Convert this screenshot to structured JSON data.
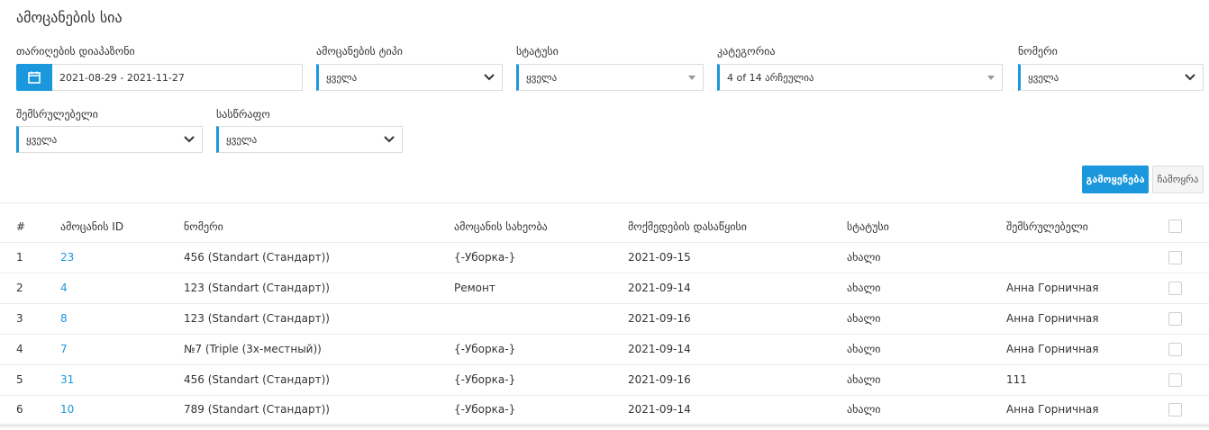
{
  "page": {
    "title": "ამოცანების სია"
  },
  "filters": {
    "date_range": {
      "label": "თარიღების დიაპაზონი",
      "value": "2021-08-29 - 2021-11-27",
      "icon": "calendar-icon"
    },
    "task_type": {
      "label": "ამოცანების ტიპი",
      "value": "ყველა"
    },
    "status": {
      "label": "სტატუსი",
      "value": "ყველა"
    },
    "category": {
      "label": "კატეგორია",
      "value": "4 of 14 არჩეულია"
    },
    "room": {
      "label": "ნომერი",
      "value": "ყველა"
    },
    "assignee": {
      "label": "შემსრულებელი",
      "value": "ყველა"
    },
    "housekeeping": {
      "label": "სასწრაფო",
      "value": "ყველა"
    }
  },
  "actions": {
    "apply_label": "გამოყენება",
    "clear_label": "ჩამოყრა"
  },
  "table": {
    "columns": [
      "#",
      "ამოცანის ID",
      "ნომერი",
      "ამოცანის სახეობა",
      "მოქმედების დასაწყისი",
      "სტატუსი",
      "შემსრულებელი"
    ],
    "rows": [
      {
        "num": "1",
        "id": "23",
        "room": "456 (Standart (Стандарт))",
        "type": "{-Уборка-}",
        "start": "2021-09-15",
        "status": "ახალი",
        "assignee": ""
      },
      {
        "num": "2",
        "id": "4",
        "room": "123 (Standart (Стандарт))",
        "type": "Ремонт",
        "start": "2021-09-14",
        "status": "ახალი",
        "assignee": "Анна Горничная"
      },
      {
        "num": "3",
        "id": "8",
        "room": "123 (Standart (Стандарт))",
        "type": "",
        "start": "2021-09-16",
        "status": "ახალი",
        "assignee": "Анна Горничная"
      },
      {
        "num": "4",
        "id": "7",
        "room": "№7 (Triple (3х-местный))",
        "type": "{-Уборка-}",
        "start": "2021-09-14",
        "status": "ახალი",
        "assignee": "Анна Горничная"
      },
      {
        "num": "5",
        "id": "31",
        "room": "456 (Standart (Стандарт))",
        "type": "{-Уборка-}",
        "start": "2021-09-16",
        "status": "ახალი",
        "assignee": "111"
      },
      {
        "num": "6",
        "id": "10",
        "room": "789 (Standart (Стандарт))",
        "type": "{-Уборка-}",
        "start": "2021-09-14",
        "status": "ახალი",
        "assignee": "Анна Горничная"
      }
    ]
  },
  "colors": {
    "accent": "#1a97dd",
    "border": "#dcdcdc"
  }
}
